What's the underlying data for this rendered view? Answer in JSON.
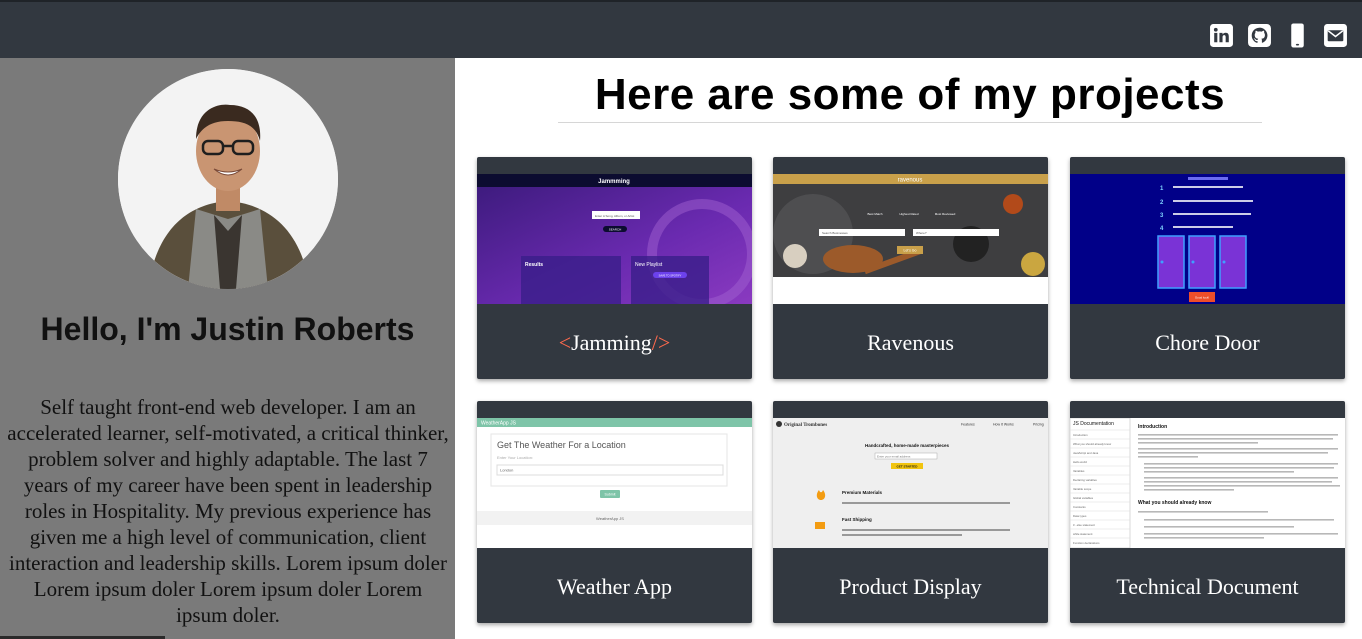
{
  "social": {
    "icons": [
      "linkedin-icon",
      "github-icon",
      "phone-icon",
      "mail-icon"
    ]
  },
  "profile": {
    "greeting": "Hello, I'm Justin Roberts",
    "bio": "Self taught front-end web developer. I am an accelerated learner, self-motivated, a critical thinker, problem solver and highly adaptable. The last 7 years of my career have been spent in leadership roles in Hospitality. My previous experience has given me a high level of communication, client interaction and leadership skills.  Lorem ipsum doler Lorem ipsum doler Lorem ipsum doler Lorem ipsum doler."
  },
  "main": {
    "heading": "Here are some of my projects"
  },
  "projects": [
    {
      "title": "Jamming",
      "prefix": "< ",
      "suffix": " />",
      "screenshot": {
        "brand": "Jammming",
        "search_placeholder": "Enter A Song, Album, or Artist",
        "search_button": "SEARCH",
        "results": "Results",
        "playlist": "New Playlist",
        "save_button": "SAVE TO SPOTIFY"
      }
    },
    {
      "title": "Ravenous",
      "screenshot": {
        "brand": "ravenous",
        "option1": "Best Match",
        "option2": "Highest Rated",
        "option3": "Most Reviewed",
        "field1": "Search Businesses",
        "field2": "Where?",
        "button": "Let's Go"
      }
    },
    {
      "title": "Chore Door",
      "screenshot": {
        "steps": [
          "1",
          "2",
          "3",
          "4"
        ],
        "button": "Good luck!"
      }
    },
    {
      "title": "Weather App",
      "screenshot": {
        "bar": "WeatherApp JS",
        "heading": "Get The Weather For a Location",
        "field_label": "Enter Your Location:",
        "field_value": "London",
        "button": "Submit",
        "footer": "WeatherApp JS"
      }
    },
    {
      "title": "Product Display",
      "screenshot": {
        "brand": "Original Trombones",
        "nav": [
          "Features",
          "How It Works",
          "Pricing"
        ],
        "headline": "Handcrafted, home-made masterpieces",
        "email": "Enter your email address",
        "button": "GET STARTED",
        "feature1": "Premium Materials",
        "feature2": "Fast Shipping"
      }
    },
    {
      "title": "Technical Document",
      "screenshot": {
        "nav_title": "JS Documentation",
        "nav_items": [
          "Introduction",
          "What you should already know",
          "JavaScript and Java",
          "Hello world",
          "Variables",
          "Declaring variables",
          "Variable scope",
          "Global variables",
          "Constants",
          "Data types",
          "if...else statement",
          "while statement",
          "Function declarations"
        ],
        "section1": "Introduction",
        "section2": "What you should already know"
      }
    }
  ]
}
